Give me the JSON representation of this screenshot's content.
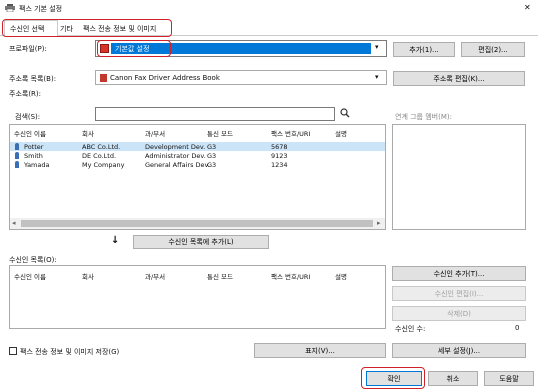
{
  "window": {
    "title": "팩스 기본 설정",
    "close": "✕"
  },
  "tabs": [
    "수신인 선택",
    "기타",
    "팩스 전송 정보 및 이미지"
  ],
  "profile": {
    "label": "프로파일(P):",
    "value": "기본값 설정",
    "add": "추가(1)...",
    "edit": "편집(2)..."
  },
  "addressbook": {
    "label": "주소록 목록(B):",
    "value": "Canon Fax Driver Address Book",
    "edit": "주소록 편집(K)...",
    "sublabel": "주소록(R):"
  },
  "search": {
    "label": "검색(S):"
  },
  "group_label": "연계 그룹 멤버(M):",
  "table": {
    "headers": [
      "수신인 이름",
      "회사",
      "과/부서",
      "통신 모드",
      "팩스 번호/URI",
      "설명"
    ],
    "rows": [
      [
        "Potter",
        "ABC Co.Ltd.",
        "Development Dev.",
        "G3",
        "5678",
        ""
      ],
      [
        "Smith",
        "DE Co.Ltd.",
        "Administrator Dev.",
        "G3",
        "9123",
        ""
      ],
      [
        "Yamada",
        "My Company",
        "General Affairs Dev.",
        "G3",
        "1234",
        ""
      ]
    ]
  },
  "add_to_list": "수신인 목록에 추가(L)",
  "recipient_list": {
    "label": "수신인 목록(O):",
    "headers": [
      "수신인 이름",
      "회사",
      "과/부서",
      "통신 모드",
      "팩스 번호/URI",
      "설명"
    ]
  },
  "side_buttons": {
    "add": "수신인 추가(T)...",
    "edit": "수신인 편집(I)...",
    "delete": "삭제(D)"
  },
  "recipient_count": {
    "label": "수신인 수:",
    "value": "0"
  },
  "bottom": {
    "checkbox": "팩스 전송 정보 및 이미지 저장(G)",
    "display": "표지(V)...",
    "details": "세부 설정(J)...",
    "ok": "확인",
    "cancel": "취소",
    "help": "도움말"
  },
  "colors": {
    "selected_row": "#cce4f7",
    "highlight": "#d0212a",
    "profile_bg": "#0078d7"
  }
}
